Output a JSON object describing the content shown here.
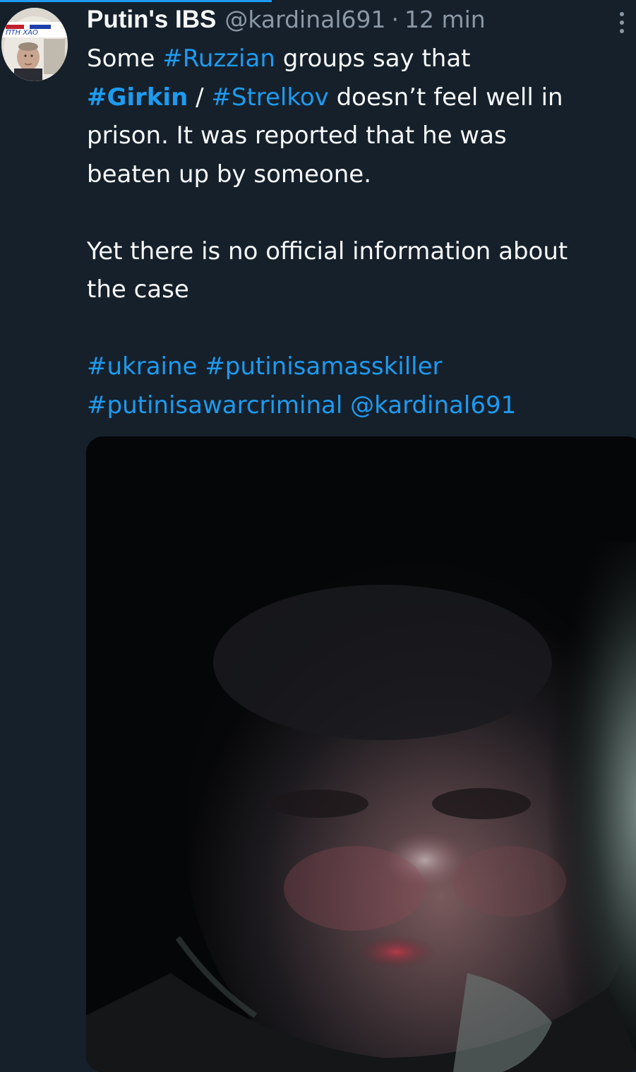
{
  "tweet": {
    "display_name": "Putin's IBS",
    "handle": "@kardinal691",
    "separator": "·",
    "time": "12 min",
    "lines": [
      {
        "t1": "Some ",
        "tag1": "#Ruzzian",
        "t2": " groups say that"
      },
      {
        "tag1": "#Girkin",
        "t1": " / ",
        "tag2": "#Strelkov",
        "t2": " doesn’t feel well in"
      },
      {
        "t1": "prison. It was reported that he was"
      },
      {
        "t1": "beaten up by someone."
      },
      {
        "t1": "Yet there is no official information about"
      },
      {
        "t1": "the case"
      },
      {
        "tag1": "#ukraine",
        "t1": " ",
        "tag2": "#putinisamasskiller"
      },
      {
        "tag1": "#putinisawarcriminal",
        "t1": " ",
        "mention": "@kardinal691"
      }
    ]
  },
  "avatar": {
    "banner_text": "ПТН ХАО"
  },
  "icons": {
    "more": "more-vertical-icon"
  },
  "colors": {
    "background": "#15202b",
    "accent": "#1d9bf0",
    "text": "#f7f9f9",
    "muted": "#8b98a5"
  }
}
